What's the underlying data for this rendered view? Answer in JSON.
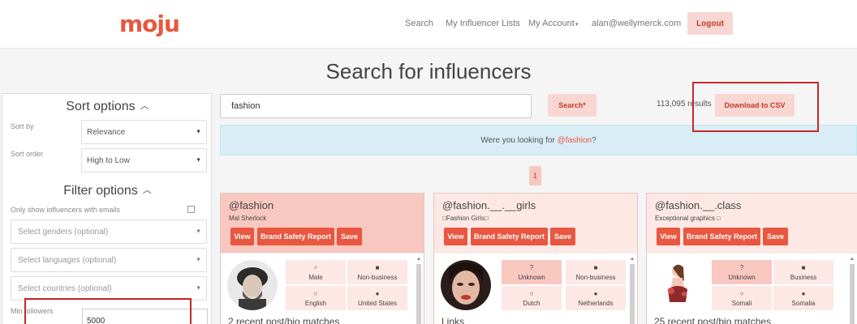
{
  "header": {
    "logo": "moju",
    "nav_search": "Search",
    "nav_lists": "My Influencer Lists",
    "nav_account": "My Account",
    "nav_account_caret": "▾",
    "nav_email": "alan@wellymerck.com",
    "logout": "Logout"
  },
  "page_title": "Search for influencers",
  "sidebar": {
    "sort_title": "Sort options",
    "sort_by_label": "Sort by",
    "sort_by_value": "Relevance",
    "sort_order_label": "Sort order",
    "sort_order_value": "High to Low",
    "filter_title": "Filter options",
    "emails_only_label": "Only show influencers with emails",
    "genders_placeholder": "Select genders (optional)",
    "languages_placeholder": "Select languages (optional)",
    "countries_placeholder": "Select countries (optional)",
    "min_followers_label": "Min followers",
    "min_followers_value": "5000",
    "collapse_glyph": "︿",
    "dropdown_glyph": "▼"
  },
  "search": {
    "query": "fashion",
    "search_button": "Search*",
    "results": "113,095 results",
    "download_button": "Download to CSV"
  },
  "notice": {
    "prefix": "Were you looking for ",
    "link": "@fashion",
    "suffix": "?"
  },
  "pagination": {
    "current": "1"
  },
  "cards": [
    {
      "handle": "@fashion",
      "subtitle": "Mal Sherlock",
      "view": "View",
      "brand_safety": "Brand Safety Report",
      "save": "Save",
      "attrs": [
        {
          "icon": "male-icon",
          "glyph": "♂",
          "label": "Male"
        },
        {
          "icon": "briefcase-icon",
          "glyph": "■",
          "label": "Non-business"
        },
        {
          "icon": "speech-bubble-icon",
          "glyph": "○",
          "label": "English"
        },
        {
          "icon": "globe-icon",
          "glyph": "●",
          "label": "United States"
        }
      ],
      "footer": "2 recent post/bio matches",
      "head_color": "#f8c7bf"
    },
    {
      "handle": "@fashion.__.__girls",
      "subtitle": "□Fashion Girls□",
      "view": "View",
      "brand_safety": "Brand Safety Report",
      "save": "Save",
      "attrs": [
        {
          "icon": "question-icon",
          "glyph": "?",
          "label": "Unknown"
        },
        {
          "icon": "briefcase-icon",
          "glyph": "■",
          "label": "Non-business"
        },
        {
          "icon": "speech-bubble-icon",
          "glyph": "○",
          "label": "Dutch"
        },
        {
          "icon": "globe-icon",
          "glyph": "●",
          "label": "Netherlands"
        }
      ],
      "footer": "Links",
      "head_color": "#fde8e5"
    },
    {
      "handle": "@fashion.__.class",
      "subtitle": "Exceptional graphics □",
      "view": "View",
      "brand_safety": "Brand Safety Report",
      "save": "Save",
      "attrs": [
        {
          "icon": "question-icon",
          "glyph": "?",
          "label": "Unknown"
        },
        {
          "icon": "briefcase-icon",
          "glyph": "■",
          "label": "Business"
        },
        {
          "icon": "speech-bubble-icon",
          "glyph": "○",
          "label": "Somali"
        },
        {
          "icon": "globe-icon",
          "glyph": "●",
          "label": "Somalia"
        }
      ],
      "footer": "25 recent post/bio matches",
      "head_color": "#fde8e5"
    }
  ],
  "scroll_up_glyph": "▲",
  "colors": {
    "accent": "#e8573f",
    "pink_button": "#f8d7d2",
    "highlight_attr": "#f8c7bf",
    "light_attr": "#fde8e5",
    "notice_bg": "#d9edf7",
    "annotation": "#c62828"
  }
}
